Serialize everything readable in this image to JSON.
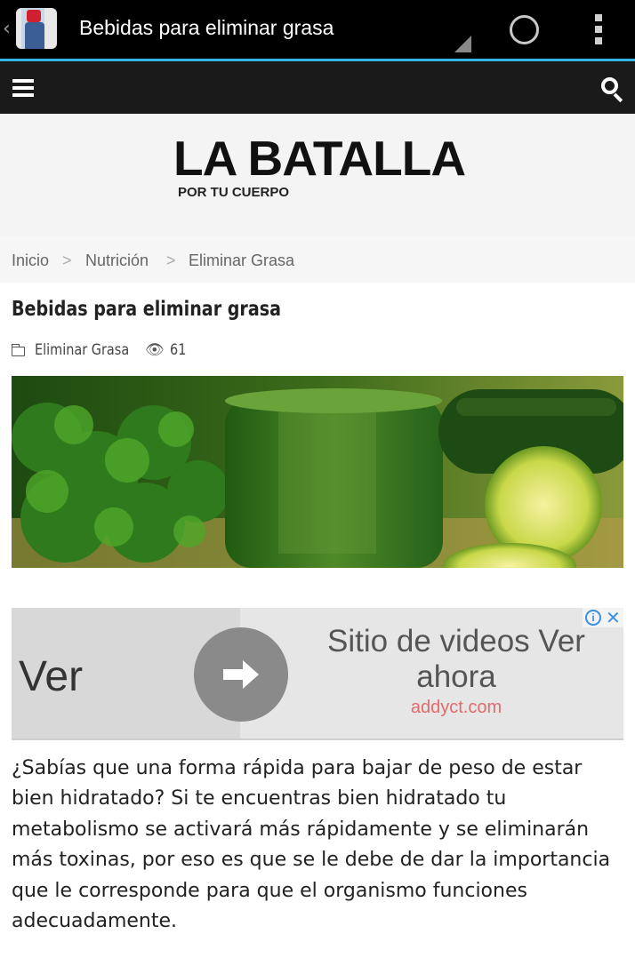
{
  "actionbar": {
    "back_glyph": "‹",
    "title": "Bebidas para eliminar grasa",
    "icons": [
      "app-icon",
      "signal-icon",
      "loading-spinner-icon",
      "overflow-menu-icon"
    ]
  },
  "site_nav": {
    "icons": [
      "hamburger-menu-icon",
      "search-icon"
    ]
  },
  "logo": {
    "main": "LA BATALLA",
    "sub": "POR TU CUERPO"
  },
  "breadcrumb": {
    "items": [
      "Inicio",
      "Nutrición",
      "Eliminar Grasa"
    ],
    "separator": ">"
  },
  "article": {
    "title": "Bebidas para eliminar grasa",
    "category": "Eliminar Grasa",
    "views": "61",
    "body": "¿Sabías que una forma rápida para bajar de peso de estar bien hidratado? Si te encuentras bien hidratado tu metabolismo se activará más rápidamente y se eliminarán más toxinas, por eso es que se le debe de dar la importancia que le corresponde para que el organismo funciones adecuadamente."
  },
  "ad": {
    "left_text": "Ver",
    "headline": "Sitio de videos Ver ahora",
    "domain": "addyct.com",
    "info_glyph": "i",
    "close_glyph": "✕"
  },
  "colors": {
    "accent_line": "#33b5e5",
    "site_bar": "#1a1a1a",
    "ad_domain": "#e46a6a",
    "ad_choices": "#3d8fe0"
  }
}
